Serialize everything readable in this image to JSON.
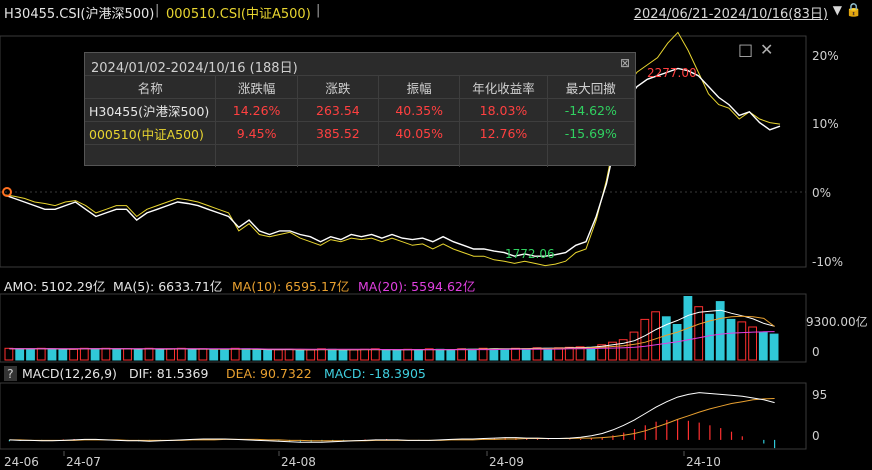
{
  "title_bar": {
    "index1": "H30455.CSI(沪港深500)",
    "separator": "|",
    "index2": "000510.CSI(中证A500)",
    "separator2": "|",
    "date_range": "2024/06/21-2024/10/16(83日)",
    "dropdown": "▼",
    "lock_icon": "lock-icon"
  },
  "price_panel": {
    "y_axis_labels": [
      "20%",
      "10%",
      "0%",
      "-10%"
    ],
    "high_label": "2277.00",
    "low_label": "1772.06"
  },
  "popup": {
    "title": "2024/01/02-2024/10/16 (188日)",
    "close": "⊠",
    "headers": [
      "名称",
      "涨跌幅",
      "涨跌",
      "振幅",
      "年化收益率",
      "最大回撤"
    ],
    "rows": [
      {
        "name": "H30455(沪港深500)",
        "chg_pct": "14.26%",
        "chg": "263.54",
        "amplitude": "40.35%",
        "annual": "18.03%",
        "drawdown": "-14.62%"
      },
      {
        "name": "000510(中证A500)",
        "chg_pct": "9.45%",
        "chg": "385.52",
        "amplitude": "40.05%",
        "annual": "12.76%",
        "drawdown": "-15.69%"
      }
    ]
  },
  "window_controls": {
    "restore": "□",
    "close": "✕"
  },
  "volume_panel": {
    "amo_label": "AMO: 5102.29亿",
    "ma5_label": "MA(5): 6633.71亿",
    "ma10_label": "MA(10): 6595.17亿",
    "ma20_label": "MA(20): 5594.62亿",
    "y_axis_labels": [
      "9300.00亿",
      "0"
    ]
  },
  "macd_panel": {
    "help": "?",
    "label": "MACD(12,26,9)",
    "dif_label": "DIF: 81.5369",
    "dea_label": "DEA: 90.7322",
    "macd_label": "MACD: -18.3905",
    "y_axis_labels": [
      "95",
      "0"
    ]
  },
  "x_axis": {
    "labels": [
      "24-06",
      "24-07",
      "24-08",
      "24-09",
      "24-10"
    ]
  },
  "colors": {
    "index1_line": "#ffffff",
    "index2_line": "#e8d530",
    "up_bar": "#ff3030",
    "down_bar": "#30c8d8",
    "ma5": "#ffffff",
    "ma10": "#e8a030",
    "ma20": "#e040e0"
  },
  "chart_data": [
    {
      "type": "line",
      "panel": "price",
      "y_unit": "%",
      "ylim": [
        -10,
        22
      ],
      "series": [
        {
          "name": "H30455.CSI(沪港深500)",
          "values": [
            0,
            -0.5,
            -1,
            -1.5,
            -2,
            -2,
            -1.5,
            -1,
            -2,
            -3,
            -2.5,
            -2,
            -2,
            -3.5,
            -2.5,
            -2,
            -1.5,
            -1,
            -1.2,
            -1.5,
            -2,
            -2.5,
            -3,
            -4.5,
            -3.5,
            -5,
            -5.5,
            -5,
            -5,
            -5.5,
            -5.8,
            -6.5,
            -5.8,
            -6.2,
            -5.5,
            -5.8,
            -5.5,
            -6,
            -5.5,
            -6,
            -6.2,
            -6,
            -6.5,
            -5.8,
            -6.5,
            -7,
            -7.5,
            -7.5,
            -7.8,
            -8,
            -8.5,
            -8.2,
            -8.5,
            -8.5,
            -8.3,
            -8,
            -7,
            -6.5,
            -3,
            1.5,
            8,
            13,
            15,
            16,
            16.5,
            17,
            17.5,
            17.2,
            16.5,
            15,
            13.5,
            12.5,
            11,
            11.5,
            10,
            9,
            9.5
          ]
        },
        {
          "name": "000510.CSI(中证A500)",
          "values": [
            0,
            -0.2,
            -0.5,
            -1,
            -1.2,
            -1.5,
            -1,
            -0.8,
            -1.5,
            -2.5,
            -2,
            -1.5,
            -1.5,
            -3,
            -2,
            -1.5,
            -1,
            -0.5,
            -0.7,
            -1,
            -1.5,
            -2,
            -2.5,
            -5,
            -4,
            -5.5,
            -5.8,
            -5.5,
            -5.2,
            -6,
            -6.5,
            -7,
            -6.2,
            -6.5,
            -6,
            -6.2,
            -6,
            -6.5,
            -6,
            -6.5,
            -7,
            -6.8,
            -7.5,
            -6.8,
            -7.5,
            -8,
            -8.5,
            -8.5,
            -9,
            -9.2,
            -9.5,
            -9.2,
            -9.5,
            -9.8,
            -9.6,
            -9.2,
            -8,
            -7.5,
            -3.5,
            2,
            9,
            15,
            17,
            18,
            19,
            21,
            22.5,
            20,
            17,
            14,
            12.5,
            12,
            10.5,
            11.5,
            10.5,
            10,
            9.8
          ]
        }
      ]
    },
    {
      "type": "bar",
      "panel": "volume",
      "ymax": 13000,
      "values": [
        2300,
        2200,
        2100,
        2300,
        2200,
        2000,
        2100,
        2300,
        2200,
        2300,
        2100,
        2200,
        2000,
        2300,
        2100,
        2200,
        2300,
        2100,
        2200,
        2000,
        2100,
        2300,
        2200,
        2100,
        1900,
        2000,
        2100,
        1900,
        2000,
        2200,
        2100,
        1900,
        2000,
        2100,
        2200,
        2000,
        1900,
        2100,
        2000,
        2200,
        2100,
        2000,
        2200,
        2100,
        2300,
        2200,
        2100,
        2300,
        2200,
        2400,
        2300,
        2400,
        2500,
        2600,
        2500,
        3000,
        3500,
        4000,
        5500,
        8000,
        9500,
        8500,
        7000,
        12500,
        10500,
        9000,
        11500,
        8000,
        7500,
        6500,
        5500,
        5102
      ],
      "up": [
        1,
        0,
        0,
        1,
        0,
        0,
        1,
        1,
        0,
        1,
        0,
        1,
        0,
        1,
        0,
        1,
        1,
        0,
        1,
        0,
        0,
        1,
        0,
        0,
        0,
        1,
        1,
        0,
        1,
        1,
        0,
        0,
        1,
        1,
        1,
        0,
        0,
        1,
        0,
        1,
        0,
        0,
        1,
        0,
        1,
        0,
        0,
        1,
        0,
        1,
        0,
        1,
        1,
        1,
        0,
        1,
        1,
        1,
        1,
        1,
        1,
        0,
        0,
        0,
        1,
        0,
        0,
        0,
        1,
        1,
        0,
        0
      ],
      "ma5": [
        2200,
        2200,
        2200,
        2200,
        2200,
        2150,
        2150,
        2200,
        2200,
        2200,
        2200,
        2200,
        2150,
        2200,
        2150,
        2150,
        2200,
        2150,
        2150,
        2150,
        2150,
        2150,
        2150,
        2100,
        2050,
        2050,
        2050,
        2000,
        2000,
        2050,
        2050,
        2000,
        2000,
        2050,
        2050,
        2050,
        2000,
        2000,
        2050,
        2050,
        2050,
        2050,
        2100,
        2100,
        2150,
        2200,
        2200,
        2200,
        2250,
        2300,
        2300,
        2350,
        2400,
        2450,
        2500,
        2700,
        3000,
        3300,
        3800,
        4800,
        6000,
        7000,
        7800,
        8800,
        9400,
        9600,
        9800,
        9200,
        8700,
        8100,
        7200,
        6634
      ],
      "ma10": [
        2200,
        2200,
        2200,
        2200,
        2200,
        2200,
        2200,
        2200,
        2200,
        2200,
        2200,
        2200,
        2200,
        2200,
        2200,
        2200,
        2200,
        2200,
        2200,
        2150,
        2150,
        2150,
        2150,
        2150,
        2100,
        2100,
        2100,
        2050,
        2050,
        2050,
        2050,
        2050,
        2050,
        2050,
        2050,
        2050,
        2050,
        2050,
        2050,
        2050,
        2050,
        2050,
        2050,
        2050,
        2100,
        2100,
        2150,
        2150,
        2200,
        2200,
        2250,
        2300,
        2300,
        2350,
        2400,
        2500,
        2650,
        2800,
        3100,
        3500,
        4200,
        4900,
        5500,
        6300,
        7100,
        7700,
        8200,
        8500,
        8600,
        8500,
        8200,
        6595
      ],
      "ma20": [
        2200,
        2200,
        2200,
        2200,
        2200,
        2200,
        2200,
        2200,
        2200,
        2200,
        2200,
        2200,
        2200,
        2200,
        2200,
        2200,
        2200,
        2200,
        2200,
        2200,
        2200,
        2200,
        2200,
        2200,
        2150,
        2150,
        2150,
        2150,
        2100,
        2100,
        2100,
        2100,
        2100,
        2100,
        2100,
        2050,
        2050,
        2050,
        2050,
        2050,
        2050,
        2050,
        2050,
        2050,
        2050,
        2050,
        2100,
        2100,
        2100,
        2100,
        2150,
        2150,
        2200,
        2200,
        2250,
        2300,
        2350,
        2400,
        2500,
        2700,
        3000,
        3300,
        3600,
        4000,
        4400,
        4800,
        5100,
        5300,
        5400,
        5500,
        5550,
        5595
      ]
    },
    {
      "type": "line",
      "panel": "macd",
      "ylim": [
        -20,
        125
      ],
      "hist": [
        -3,
        -2,
        -2,
        -1,
        0,
        1,
        2,
        2,
        1,
        0,
        -1,
        -2,
        -3,
        -3,
        -2,
        -1,
        0,
        1,
        2,
        3,
        3,
        2,
        1,
        0,
        -1,
        -2,
        -3,
        -4,
        -4,
        -3,
        -2,
        -1,
        0,
        1,
        1,
        2,
        1,
        0,
        -1,
        -1,
        0,
        1,
        2,
        3,
        3,
        4,
        5,
        4,
        3,
        2,
        1,
        0,
        1,
        2,
        4,
        6,
        10,
        16,
        24,
        32,
        40,
        44,
        46,
        42,
        38,
        32,
        26,
        18,
        8,
        0,
        -8,
        -18
      ],
      "dif": [
        0,
        -1,
        -1,
        -2,
        -2,
        -1,
        0,
        1,
        1,
        0,
        -1,
        -2,
        -2,
        -3,
        -2,
        -1,
        0,
        1,
        2,
        2,
        2,
        1,
        0,
        -1,
        -2,
        -3,
        -4,
        -5,
        -5,
        -5,
        -4,
        -3,
        -2,
        -1,
        0,
        0,
        0,
        -1,
        -1,
        -1,
        0,
        1,
        2,
        2,
        3,
        4,
        5,
        5,
        4,
        4,
        3,
        3,
        4,
        6,
        9,
        14,
        22,
        32,
        44,
        58,
        72,
        84,
        94,
        100,
        104,
        102,
        100,
        98,
        96,
        92,
        88,
        82
      ],
      "dea": [
        0,
        0,
        -1,
        -1,
        -1,
        -1,
        -1,
        0,
        0,
        0,
        0,
        -1,
        -1,
        -1,
        -1,
        -1,
        -1,
        0,
        0,
        0,
        1,
        1,
        1,
        1,
        0,
        0,
        -1,
        -1,
        -2,
        -2,
        -2,
        -2,
        -2,
        -2,
        -1,
        -1,
        -1,
        -1,
        -1,
        -1,
        -1,
        0,
        0,
        0,
        1,
        1,
        2,
        2,
        3,
        3,
        3,
        3,
        3,
        4,
        4,
        5,
        7,
        10,
        14,
        20,
        28,
        36,
        45,
        53,
        61,
        68,
        74,
        80,
        84,
        88,
        90,
        91
      ]
    }
  ]
}
